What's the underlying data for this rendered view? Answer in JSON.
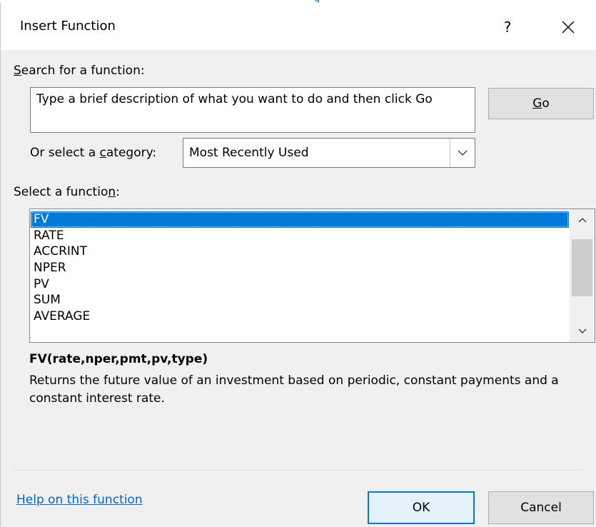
{
  "dialog": {
    "title": "Insert Function",
    "help_label": "?",
    "close_label": "✕"
  },
  "search": {
    "label_accel": "S",
    "label_rest": "earch for a function:",
    "value": "Type a brief description of what you want to do and then click Go",
    "go_accel": "G",
    "go_rest": "o"
  },
  "category": {
    "label_pre": "Or select a ",
    "label_accel": "c",
    "label_post": "ategory:",
    "selected": "Most Recently Used"
  },
  "functions": {
    "label_pre": "Select a functio",
    "label_accel": "n",
    "label_post": ":",
    "items": [
      "FV",
      "RATE",
      "ACCRINT",
      "NPER",
      "PV",
      "SUM",
      "AVERAGE"
    ],
    "selected_index": 0
  },
  "details": {
    "signature": "FV(rate,nper,pmt,pv,type)",
    "description": "Returns the future value of an investment based on periodic, constant payments and a constant interest rate."
  },
  "footer": {
    "help_link": "Help on this function",
    "ok_label": "OK",
    "cancel_label": "Cancel"
  },
  "colors": {
    "selection": "#0078d7",
    "link": "#0066cc",
    "dialog_bg": "#f0f0f0"
  }
}
